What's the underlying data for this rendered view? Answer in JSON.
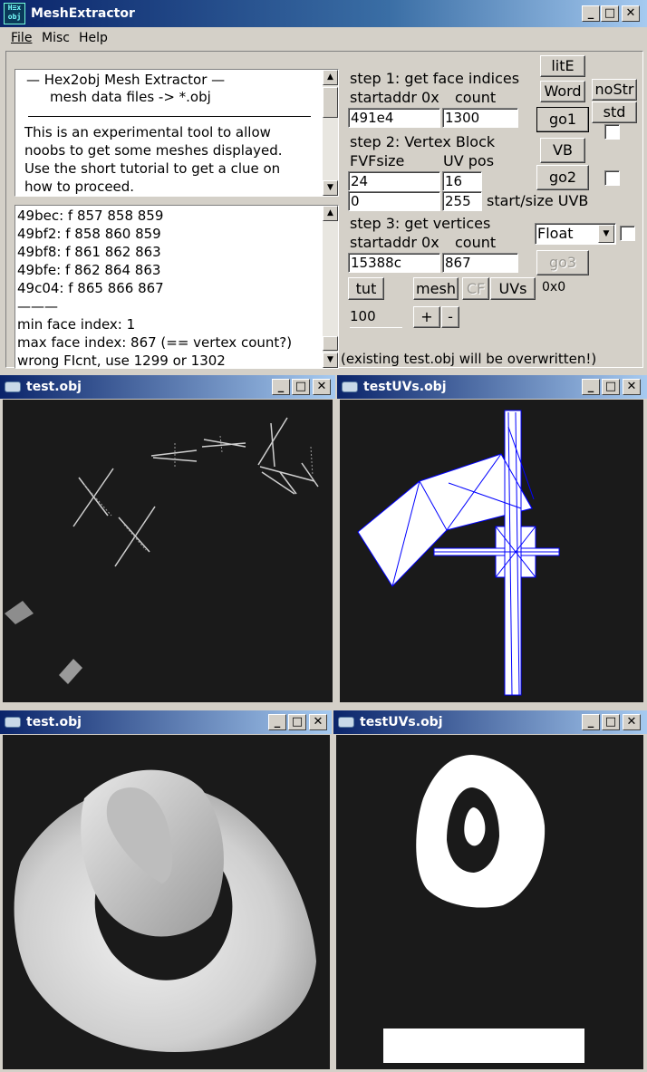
{
  "app": {
    "icon_text_top": "H≡x",
    "icon_text_bottom": "obj",
    "title": "MeshExtractor",
    "minimize": "_",
    "maximize": "□",
    "close": "✕"
  },
  "menu": [
    "File",
    "Misc",
    "Help"
  ],
  "info": {
    "lines": [
      "—   Hex2obj Mesh Extractor   —",
      "mesh data files -> *.obj",
      "This is an experimental tool to allow",
      "noobs to get some meshes displayed.",
      "Use the short tutorial to get a clue on",
      "how to proceed."
    ]
  },
  "log": {
    "lines": [
      "49bec: f  857 858 859",
      "49bf2: f  858 860 859",
      "49bf8: f  861 862 863",
      "49bfe: f  862 864 863",
      "49c04: f  865 866 867",
      "———",
      "min face index: 1",
      "max face index: 867 (== vertex count?)",
      "wrong FIcnt, use 1299 or 1302"
    ]
  },
  "step1": {
    "label": "step 1: get face indices",
    "startaddr_label": "startaddr 0x",
    "count_label": "count",
    "startaddr": "491e4",
    "count": "1300"
  },
  "step2": {
    "label": "step 2: Vertex Block",
    "fvf_label": "FVFsize",
    "uvpos_label": "UV pos",
    "fvfsize": "24",
    "uvpos": "16",
    "uvb_start": "0",
    "uvb_size": "255",
    "uvb_label": "start/size UVB"
  },
  "step3": {
    "label": "step 3: get vertices",
    "startaddr_label": "startaddr 0x",
    "count_label": "count",
    "startaddr": "15388c",
    "count": "867",
    "format": "Float"
  },
  "buttons": {
    "lite": "litE",
    "word": "Word",
    "nostr": "noStr",
    "std": "std",
    "go1": "go1",
    "vb": "VB",
    "go2": "go2",
    "go3": "go3",
    "tut": "tut",
    "mesh": "mesh",
    "cf": "CF",
    "uvs": "UVs",
    "size_readout": "0x0",
    "plus": "+",
    "minus": "-"
  },
  "scale_value": "100",
  "warning": "(existing test.obj will be overwritten!)",
  "child_windows": [
    {
      "title": "test.obj"
    },
    {
      "title": "testUVs.obj"
    },
    {
      "title": "test.obj"
    },
    {
      "title": "testUVs.obj"
    }
  ],
  "colors": {
    "title_active": "#0a246a",
    "uv_wire": "#0000ff",
    "viewport_bg": "#1a1a1a"
  }
}
